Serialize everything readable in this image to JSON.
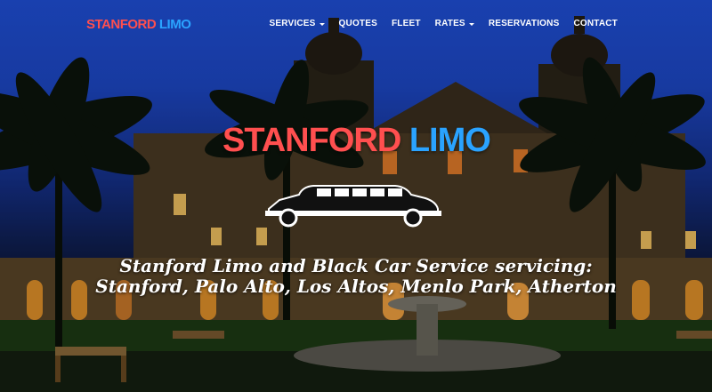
{
  "nav": {
    "brand": {
      "word1": "STANFORD",
      "word2": "LIMO"
    },
    "items": [
      {
        "label": "SERVICES",
        "dropdown": true
      },
      {
        "label": "QUOTES",
        "dropdown": false
      },
      {
        "label": "FLEET",
        "dropdown": false
      },
      {
        "label": "RATES",
        "dropdown": true
      },
      {
        "label": "RESERVATIONS",
        "dropdown": false
      },
      {
        "label": "CONTACT",
        "dropdown": false
      }
    ]
  },
  "hero": {
    "logo": {
      "word1": "STANFORD",
      "word2": "LIMO"
    },
    "limo_icon": "limousine-icon",
    "tagline_line1": "Stanford Limo and Black Car Service servicing:",
    "tagline_line2": "Stanford, Palo Alto, Los Altos, Menlo Park, Atherton"
  },
  "colors": {
    "brand_red": "#ff4f4f",
    "brand_blue": "#2aa3ff",
    "nav_text": "#ffffff"
  }
}
